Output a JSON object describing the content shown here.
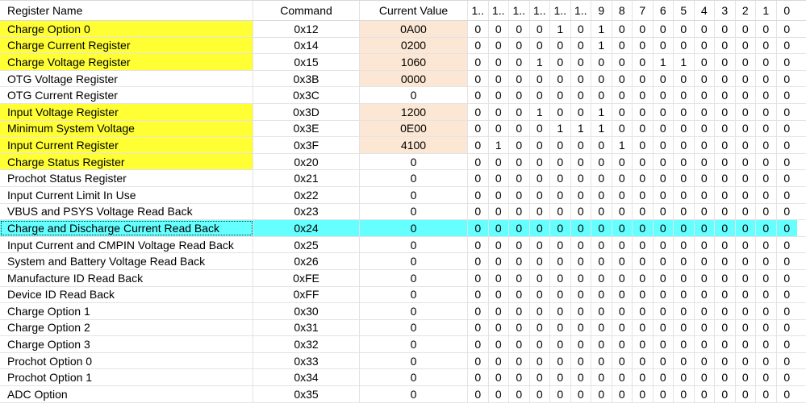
{
  "table": {
    "headers": {
      "name": "Register Name",
      "command": "Command",
      "value": "Current Value",
      "bits": [
        "1..",
        "1..",
        "1..",
        "1..",
        "1..",
        "1..",
        "9",
        "8",
        "7",
        "6",
        "5",
        "4",
        "3",
        "2",
        "1",
        "0"
      ]
    },
    "highlight_color": "#ffff33",
    "value_fill_color": "#fbe7d3",
    "selected_row_color": "#66ffff",
    "rows": [
      {
        "name": "Charge Option 0",
        "command": "0x12",
        "value": "0A00",
        "bits": [
          "0",
          "0",
          "0",
          "0",
          "1",
          "0",
          "1",
          "0",
          "0",
          "0",
          "0",
          "0",
          "0",
          "0",
          "0",
          "0"
        ],
        "name_highlight": true,
        "value_filled": true
      },
      {
        "name": "Charge Current Register",
        "command": "0x14",
        "value": "0200",
        "bits": [
          "0",
          "0",
          "0",
          "0",
          "0",
          "0",
          "1",
          "0",
          "0",
          "0",
          "0",
          "0",
          "0",
          "0",
          "0",
          "0"
        ],
        "name_highlight": true,
        "value_filled": true
      },
      {
        "name": "Charge Voltage Register",
        "command": "0x15",
        "value": "1060",
        "bits": [
          "0",
          "0",
          "0",
          "1",
          "0",
          "0",
          "0",
          "0",
          "0",
          "1",
          "1",
          "0",
          "0",
          "0",
          "0",
          "0"
        ],
        "name_highlight": true,
        "value_filled": true
      },
      {
        "name": "OTG Voltage Register",
        "command": "0x3B",
        "value": "0000",
        "bits": [
          "0",
          "0",
          "0",
          "0",
          "0",
          "0",
          "0",
          "0",
          "0",
          "0",
          "0",
          "0",
          "0",
          "0",
          "0",
          "0"
        ],
        "name_highlight": false,
        "value_filled": true
      },
      {
        "name": "OTG Current Register",
        "command": "0x3C",
        "value": "0",
        "bits": [
          "0",
          "0",
          "0",
          "0",
          "0",
          "0",
          "0",
          "0",
          "0",
          "0",
          "0",
          "0",
          "0",
          "0",
          "0",
          "0"
        ],
        "name_highlight": false,
        "value_filled": false
      },
      {
        "name": "Input Voltage Register",
        "command": "0x3D",
        "value": "1200",
        "bits": [
          "0",
          "0",
          "0",
          "1",
          "0",
          "0",
          "1",
          "0",
          "0",
          "0",
          "0",
          "0",
          "0",
          "0",
          "0",
          "0"
        ],
        "name_highlight": true,
        "value_filled": true
      },
      {
        "name": "Minimum System Voltage",
        "command": "0x3E",
        "value": "0E00",
        "bits": [
          "0",
          "0",
          "0",
          "0",
          "1",
          "1",
          "1",
          "0",
          "0",
          "0",
          "0",
          "0",
          "0",
          "0",
          "0",
          "0"
        ],
        "name_highlight": true,
        "value_filled": true
      },
      {
        "name": "Input Current Register",
        "command": "0x3F",
        "value": "4100",
        "bits": [
          "0",
          "1",
          "0",
          "0",
          "0",
          "0",
          "0",
          "1",
          "0",
          "0",
          "0",
          "0",
          "0",
          "0",
          "0",
          "0"
        ],
        "name_highlight": true,
        "value_filled": true
      },
      {
        "name": "Charge Status Register",
        "command": "0x20",
        "value": "0",
        "bits": [
          "0",
          "0",
          "0",
          "0",
          "0",
          "0",
          "0",
          "0",
          "0",
          "0",
          "0",
          "0",
          "0",
          "0",
          "0",
          "0"
        ],
        "name_highlight": true,
        "value_filled": false
      },
      {
        "name": "Prochot Status Register",
        "command": "0x21",
        "value": "0",
        "bits": [
          "0",
          "0",
          "0",
          "0",
          "0",
          "0",
          "0",
          "0",
          "0",
          "0",
          "0",
          "0",
          "0",
          "0",
          "0",
          "0"
        ],
        "name_highlight": false,
        "value_filled": false
      },
      {
        "name": "Input Current Limit In Use",
        "command": "0x22",
        "value": "0",
        "bits": [
          "0",
          "0",
          "0",
          "0",
          "0",
          "0",
          "0",
          "0",
          "0",
          "0",
          "0",
          "0",
          "0",
          "0",
          "0",
          "0"
        ],
        "name_highlight": false,
        "value_filled": false
      },
      {
        "name": "VBUS and PSYS Voltage Read Back",
        "command": "0x23",
        "value": "0",
        "bits": [
          "0",
          "0",
          "0",
          "0",
          "0",
          "0",
          "0",
          "0",
          "0",
          "0",
          "0",
          "0",
          "0",
          "0",
          "0",
          "0"
        ],
        "name_highlight": false,
        "value_filled": false
      },
      {
        "name": "Charge and Discharge Current Read Back",
        "command": "0x24",
        "value": "0",
        "bits": [
          "0",
          "0",
          "0",
          "0",
          "0",
          "0",
          "0",
          "0",
          "0",
          "0",
          "0",
          "0",
          "0",
          "0",
          "0",
          "0"
        ],
        "name_highlight": false,
        "value_filled": false,
        "selected": true
      },
      {
        "name": "Input Current and CMPIN Voltage Read Back",
        "command": "0x25",
        "value": "0",
        "bits": [
          "0",
          "0",
          "0",
          "0",
          "0",
          "0",
          "0",
          "0",
          "0",
          "0",
          "0",
          "0",
          "0",
          "0",
          "0",
          "0"
        ],
        "name_highlight": false,
        "value_filled": false
      },
      {
        "name": "System and Battery Voltage Read Back",
        "command": "0x26",
        "value": "0",
        "bits": [
          "0",
          "0",
          "0",
          "0",
          "0",
          "0",
          "0",
          "0",
          "0",
          "0",
          "0",
          "0",
          "0",
          "0",
          "0",
          "0"
        ],
        "name_highlight": false,
        "value_filled": false
      },
      {
        "name": "Manufacture ID Read Back",
        "command": "0xFE",
        "value": "0",
        "bits": [
          "0",
          "0",
          "0",
          "0",
          "0",
          "0",
          "0",
          "0",
          "0",
          "0",
          "0",
          "0",
          "0",
          "0",
          "0",
          "0"
        ],
        "name_highlight": false,
        "value_filled": false
      },
      {
        "name": "Device ID Read Back",
        "command": "0xFF",
        "value": "0",
        "bits": [
          "0",
          "0",
          "0",
          "0",
          "0",
          "0",
          "0",
          "0",
          "0",
          "0",
          "0",
          "0",
          "0",
          "0",
          "0",
          "0"
        ],
        "name_highlight": false,
        "value_filled": false
      },
      {
        "name": "Charge Option 1",
        "command": "0x30",
        "value": "0",
        "bits": [
          "0",
          "0",
          "0",
          "0",
          "0",
          "0",
          "0",
          "0",
          "0",
          "0",
          "0",
          "0",
          "0",
          "0",
          "0",
          "0"
        ],
        "name_highlight": false,
        "value_filled": false
      },
      {
        "name": "Charge Option 2",
        "command": "0x31",
        "value": "0",
        "bits": [
          "0",
          "0",
          "0",
          "0",
          "0",
          "0",
          "0",
          "0",
          "0",
          "0",
          "0",
          "0",
          "0",
          "0",
          "0",
          "0"
        ],
        "name_highlight": false,
        "value_filled": false
      },
      {
        "name": "Charge Option 3",
        "command": "0x32",
        "value": "0",
        "bits": [
          "0",
          "0",
          "0",
          "0",
          "0",
          "0",
          "0",
          "0",
          "0",
          "0",
          "0",
          "0",
          "0",
          "0",
          "0",
          "0"
        ],
        "name_highlight": false,
        "value_filled": false
      },
      {
        "name": "Prochot Option 0",
        "command": "0x33",
        "value": "0",
        "bits": [
          "0",
          "0",
          "0",
          "0",
          "0",
          "0",
          "0",
          "0",
          "0",
          "0",
          "0",
          "0",
          "0",
          "0",
          "0",
          "0"
        ],
        "name_highlight": false,
        "value_filled": false
      },
      {
        "name": "Prochot Option 1",
        "command": "0x34",
        "value": "0",
        "bits": [
          "0",
          "0",
          "0",
          "0",
          "0",
          "0",
          "0",
          "0",
          "0",
          "0",
          "0",
          "0",
          "0",
          "0",
          "0",
          "0"
        ],
        "name_highlight": false,
        "value_filled": false
      },
      {
        "name": "ADC Option",
        "command": "0x35",
        "value": "0",
        "bits": [
          "0",
          "0",
          "0",
          "0",
          "0",
          "0",
          "0",
          "0",
          "0",
          "0",
          "0",
          "0",
          "0",
          "0",
          "0",
          "0"
        ],
        "name_highlight": false,
        "value_filled": false
      }
    ]
  }
}
